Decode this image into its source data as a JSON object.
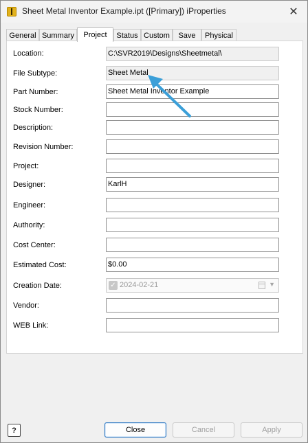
{
  "window": {
    "title": "Sheet Metal Inventor Example.ipt ([Primary]) iProperties"
  },
  "tabs": [
    {
      "label": "General",
      "active": false
    },
    {
      "label": "Summary",
      "active": false
    },
    {
      "label": "Project",
      "active": true
    },
    {
      "label": "Status",
      "active": false
    },
    {
      "label": "Custom",
      "active": false
    },
    {
      "label": "Save",
      "active": false
    },
    {
      "label": "Physical",
      "active": false
    }
  ],
  "fields": {
    "location": {
      "label": "Location:",
      "value": "C:\\SVR2019\\Designs\\Sheetmetal\\"
    },
    "file_subtype": {
      "label": "File Subtype:",
      "value": "Sheet Metal"
    },
    "part_number": {
      "label": "Part Number:",
      "value": "Sheet Metal Inventor Example"
    },
    "stock_number": {
      "label": "Stock Number:",
      "value": ""
    },
    "description": {
      "label": "Description:",
      "value": ""
    },
    "revision_number": {
      "label": "Revision Number:",
      "value": ""
    },
    "project": {
      "label": "Project:",
      "value": ""
    },
    "designer": {
      "label": "Designer:",
      "value": "KarlH"
    },
    "engineer": {
      "label": "Engineer:",
      "value": ""
    },
    "authority": {
      "label": "Authority:",
      "value": ""
    },
    "cost_center": {
      "label": "Cost Center:",
      "value": ""
    },
    "estimated_cost": {
      "label": "Estimated Cost:",
      "value": "$0.00"
    },
    "creation_date": {
      "label": "Creation Date:",
      "value": "2024-02-21",
      "checked": true
    },
    "vendor": {
      "label": "Vendor:",
      "value": ""
    },
    "web_link": {
      "label": "WEB Link:",
      "value": ""
    }
  },
  "buttons": {
    "help": "?",
    "close": "Close",
    "cancel": "Cancel",
    "apply": "Apply"
  },
  "colors": {
    "annotation_arrow": "#3b9fd8",
    "primary_button_border": "#1f6fbf",
    "app_icon": "#e2b21c"
  },
  "icons": {
    "app": "inventor-app-icon",
    "close": "close-icon",
    "calendar": "calendar-icon",
    "dropdown": "chevron-down-icon",
    "checkbox": "checkmark-icon",
    "help": "help-icon"
  }
}
